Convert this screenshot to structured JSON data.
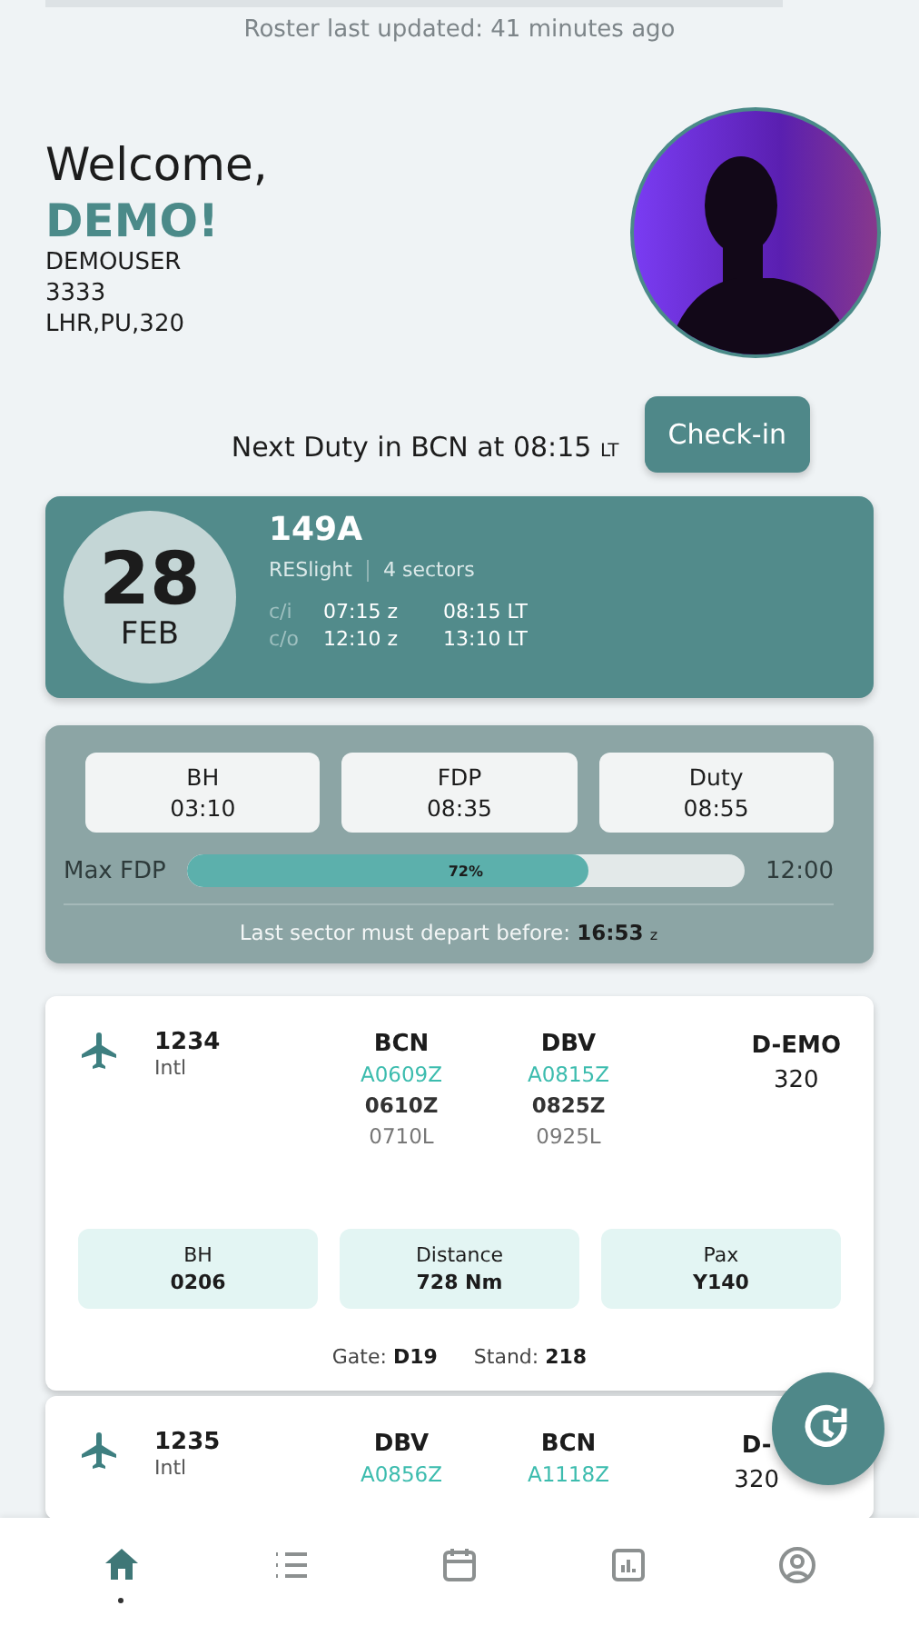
{
  "roster_status": "Roster last updated: 41 minutes ago",
  "welcome": {
    "greeting": "Welcome,",
    "name": "DEMO!",
    "username": "DEMOUSER",
    "staff_number": "3333",
    "qualifications": "LHR,PU,320"
  },
  "next_duty": {
    "text": "Next Duty in BCN at 08:15",
    "suffix": "LT",
    "button": "Check-in"
  },
  "duty": {
    "day": "28",
    "month": "FEB",
    "code": "149A",
    "type": "RESlight",
    "sectors": "4 sectors",
    "times": [
      {
        "label": "c/i",
        "utc": "07:15 z",
        "local": "08:15 LT"
      },
      {
        "label": "c/o",
        "utc": "12:10 z",
        "local": "13:10 LT"
      }
    ]
  },
  "stats": {
    "tiles": [
      {
        "label": "BH",
        "value": "03:10"
      },
      {
        "label": "FDP",
        "value": "08:35"
      },
      {
        "label": "Duty",
        "value": "08:55"
      }
    ],
    "max_fdp": {
      "label": "Max FDP",
      "level": 0.72,
      "reading": "72%",
      "limit": "12:00"
    },
    "last_sector": {
      "text": "Last sector must depart before:",
      "time": "16:53",
      "unit": "z"
    }
  },
  "flights": [
    {
      "number": "1234",
      "category": "Intl",
      "from": {
        "code": "BCN",
        "actual": "A0609Z",
        "utc": "0610Z",
        "local": "0710L"
      },
      "to": {
        "code": "DBV",
        "actual": "A0815Z",
        "utc": "0825Z",
        "local": "0925L"
      },
      "registration": "D-EMO",
      "aircraft": "320",
      "tiles": [
        {
          "label": "BH",
          "value": "0206"
        },
        {
          "label": "Distance",
          "value": "728 Nm"
        },
        {
          "label": "Pax",
          "value": "Y140"
        }
      ],
      "gate_label": "Gate:",
      "gate": "D19",
      "stand_label": "Stand:",
      "stand": "218"
    },
    {
      "number": "1235",
      "category": "Intl",
      "from": {
        "code": "DBV",
        "actual": "A0856Z"
      },
      "to": {
        "code": "BCN",
        "actual": "A1118Z"
      },
      "registration": "D-",
      "aircraft": "320"
    }
  ],
  "nav": [
    {
      "kind": "home",
      "selected": true
    },
    {
      "kind": "list",
      "selected": false
    },
    {
      "kind": "calendar",
      "selected": false
    },
    {
      "kind": "chart",
      "selected": false
    },
    {
      "kind": "profile",
      "selected": false
    }
  ]
}
